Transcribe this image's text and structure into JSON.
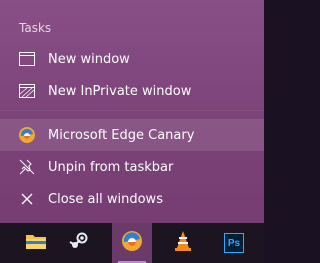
{
  "jumplist": {
    "section_title": "Tasks",
    "tasks": [
      {
        "label": "New window",
        "icon": "window-icon"
      },
      {
        "label": "New InPrivate window",
        "icon": "inprivate-window-icon"
      }
    ],
    "app_actions": [
      {
        "label": "Microsoft Edge Canary",
        "icon": "edge-canary-icon"
      },
      {
        "label": "Unpin from taskbar",
        "icon": "unpin-icon"
      },
      {
        "label": "Close all windows",
        "icon": "close-icon"
      }
    ]
  },
  "taskbar": {
    "items": [
      {
        "name": "file-explorer",
        "icon": "folder-icon"
      },
      {
        "name": "steam",
        "icon": "steam-icon"
      },
      {
        "name": "edge-canary",
        "icon": "edge-canary-icon",
        "active": true
      },
      {
        "name": "vlc",
        "icon": "vlc-cone-icon"
      },
      {
        "name": "photoshop",
        "icon": "photoshop-icon",
        "text": "Ps"
      }
    ]
  },
  "colors": {
    "jumplist_bg": "#7c4379",
    "taskbar_bg": "#1d1421",
    "active_tab": "#6a3a69",
    "photoshop_blue": "#31a8ff",
    "vlc_orange": "#f48a1e"
  }
}
